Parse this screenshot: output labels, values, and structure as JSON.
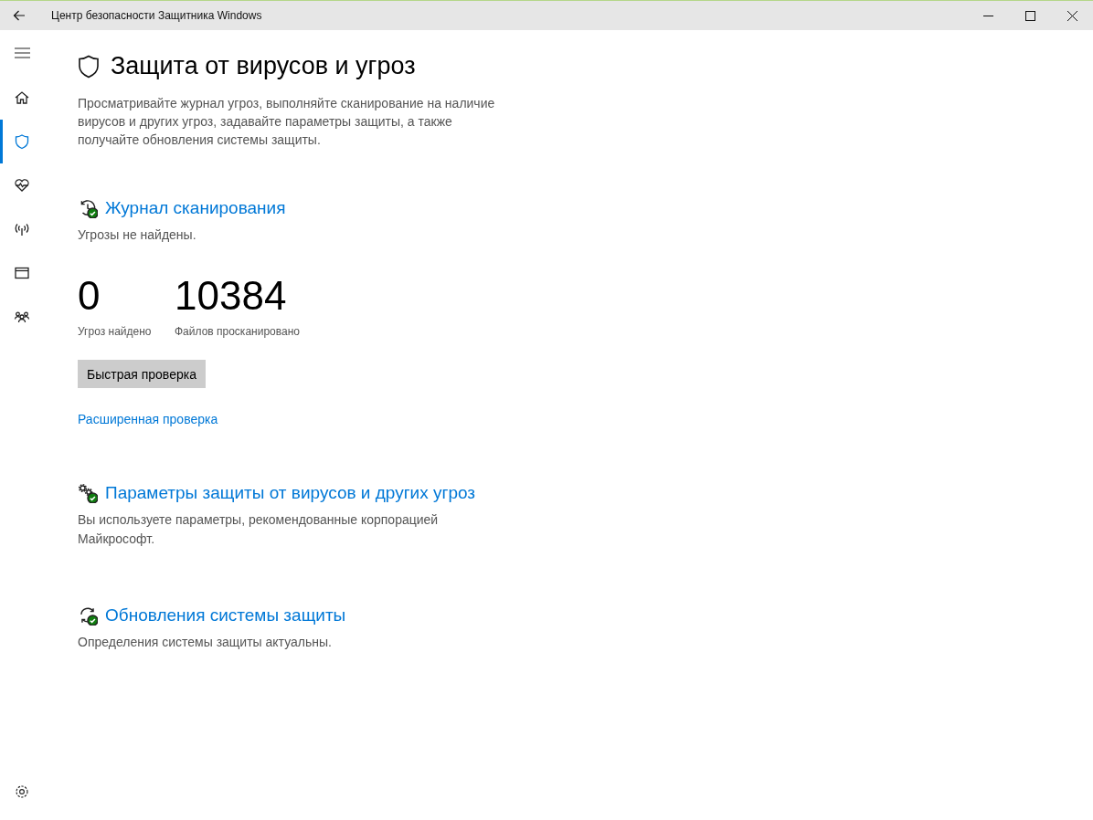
{
  "window": {
    "title": "Центр безопасности Защитника Windows"
  },
  "sidebar": {
    "items": [
      {
        "kind": "home",
        "selected": false
      },
      {
        "kind": "shield",
        "selected": true
      },
      {
        "kind": "health",
        "selected": false
      },
      {
        "kind": "network",
        "selected": false
      },
      {
        "kind": "browser",
        "selected": false
      },
      {
        "kind": "family",
        "selected": false
      }
    ]
  },
  "page": {
    "title": "Защита от вирусов и угроз",
    "description": "Просматривайте журнал угроз, выполняйте сканирование на наличие вирусов и других угроз, задавайте параметры защиты, а также получайте обновления системы защиты."
  },
  "sections": [
    {
      "kind": "history",
      "title": "Журнал сканирования",
      "status": "Угрозы не найдены.",
      "stats": [
        {
          "value": "0",
          "label": "Угроз найдено"
        },
        {
          "value": "10384",
          "label": "Файлов просканировано"
        }
      ],
      "button": "Быстрая проверка",
      "link": "Расширенная проверка"
    },
    {
      "kind": "settings",
      "title": "Параметры защиты от вирусов и других угроз",
      "status": "Вы используете параметры, рекомендованные корпорацией Майкрософт."
    },
    {
      "kind": "update",
      "title": "Обновления системы защиты",
      "status": "Определения системы защиты актуальны."
    }
  ]
}
